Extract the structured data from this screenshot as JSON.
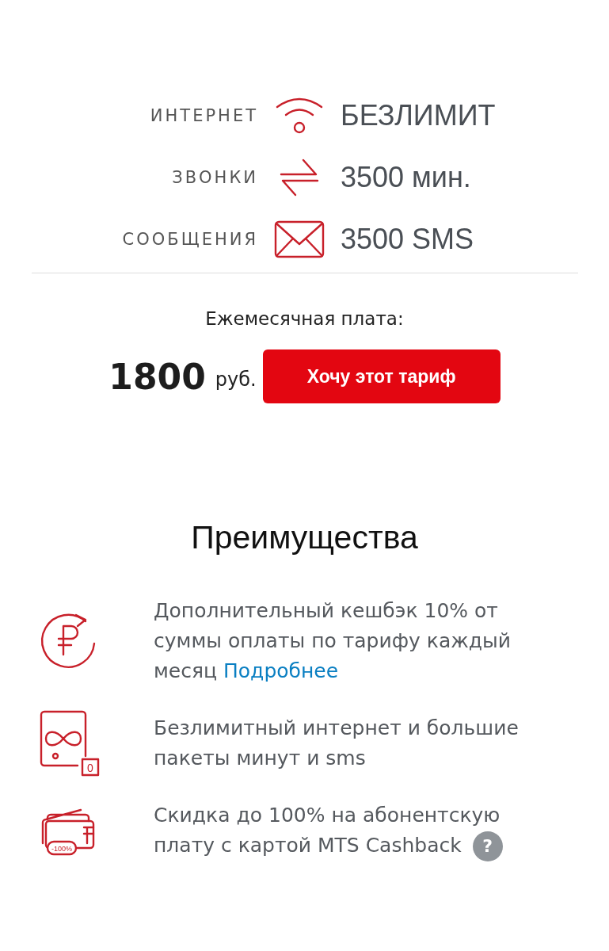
{
  "tariff": [
    {
      "kind": "internet",
      "label": "ИНТЕРНЕТ",
      "value": "БЕЗЛИМИТ"
    },
    {
      "kind": "calls",
      "label": "ЗВОНКИ",
      "value": "3500 мин."
    },
    {
      "kind": "sms",
      "label": "СООБЩЕНИЯ",
      "value": "3500 SMS"
    }
  ],
  "fee": {
    "label": "Ежемесячная плата:",
    "amount": "1800",
    "currency": "руб.",
    "button": "Хочу этот тариф"
  },
  "advantages": {
    "title": "Преимущества",
    "items": [
      {
        "kind": "cashback",
        "text": "Дополнительный кешбэк 10% от суммы оплаты по тарифу каждый месяц",
        "link": "Подробнее"
      },
      {
        "kind": "unlimited",
        "text": "Безлимитный интернет и большие пакеты минут и sms",
        "icon_text": "0"
      },
      {
        "kind": "discount",
        "text": "Скидка до 100% на абонентскую плату с картой MTS Cashback",
        "icon_text": "-100%",
        "help": "?"
      }
    ]
  }
}
